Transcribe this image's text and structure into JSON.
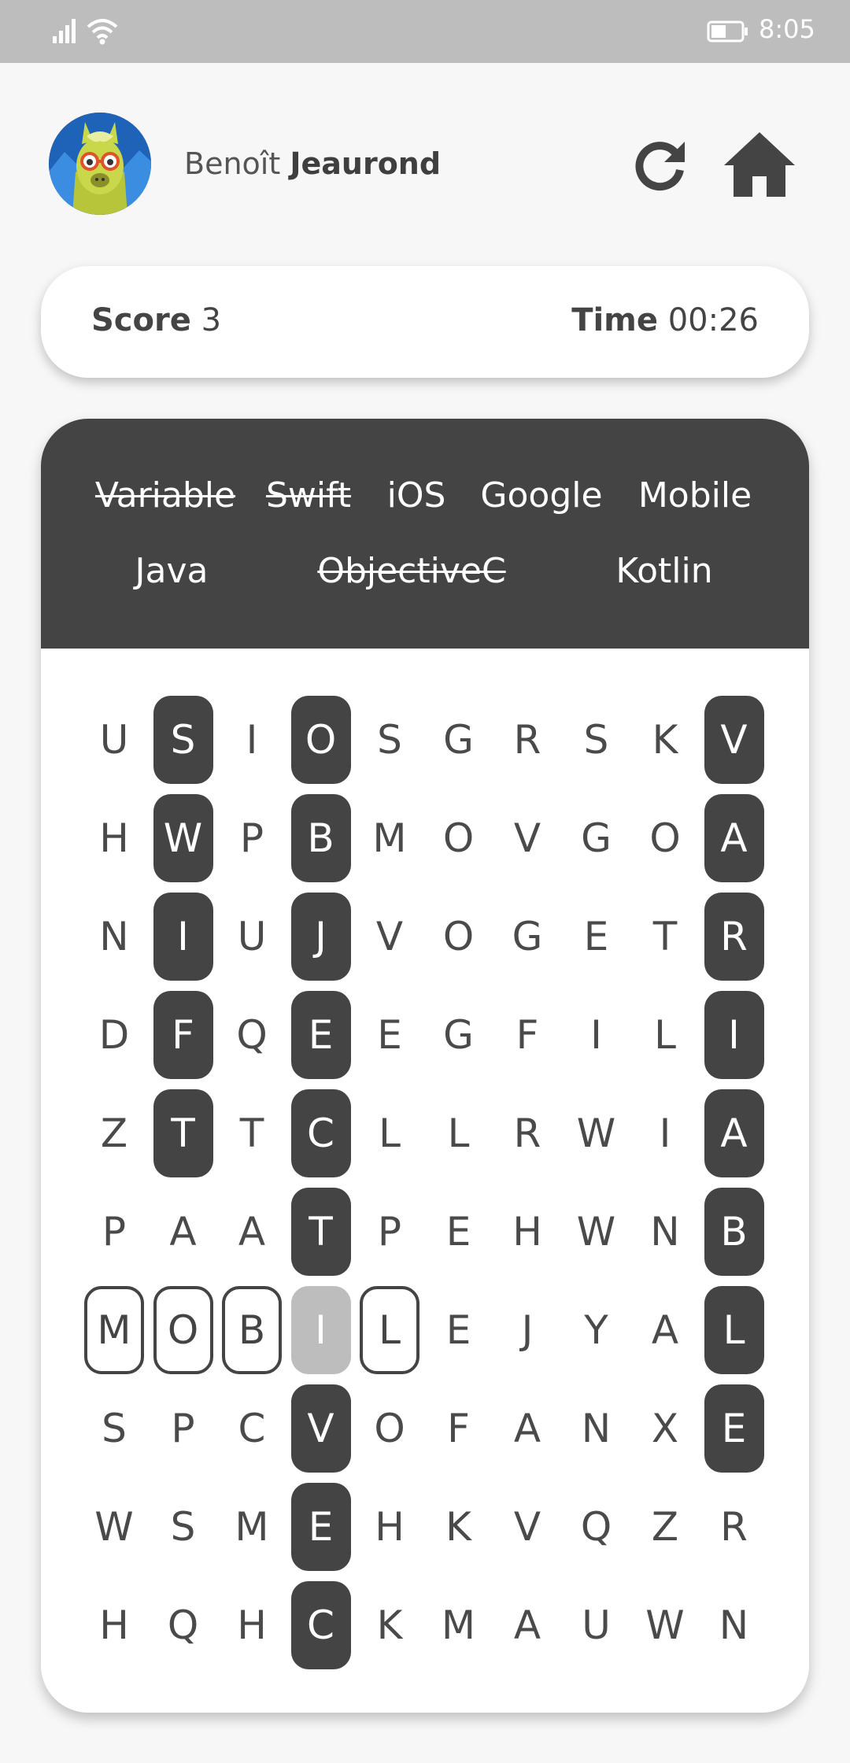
{
  "status_bar": {
    "time": "8:05"
  },
  "header": {
    "user_first": "Benoît",
    "user_last": "Jeaurond",
    "avatar_icon": "llama-avatar",
    "refresh_icon": "refresh-icon",
    "home_icon": "home-icon"
  },
  "score_bar": {
    "score_label": "Score",
    "score_value": "3",
    "time_label": "Time",
    "time_value": "00:26"
  },
  "word_list": [
    {
      "text": "Variable",
      "found": true
    },
    {
      "text": "Swift",
      "found": true
    },
    {
      "text": "iOS",
      "found": false
    },
    {
      "text": "Google",
      "found": false
    },
    {
      "text": "Mobile",
      "found": false
    },
    {
      "text": "Java",
      "found": false
    },
    {
      "text": "ObjectiveC",
      "found": true
    },
    {
      "text": "Kotlin",
      "found": false
    }
  ],
  "grid": [
    [
      "U",
      "S",
      "I",
      "O",
      "S",
      "G",
      "R",
      "S",
      "K",
      "V"
    ],
    [
      "H",
      "W",
      "P",
      "B",
      "M",
      "O",
      "V",
      "G",
      "O",
      "A"
    ],
    [
      "N",
      "I",
      "U",
      "J",
      "V",
      "O",
      "G",
      "E",
      "T",
      "R"
    ],
    [
      "D",
      "F",
      "Q",
      "E",
      "E",
      "G",
      "F",
      "I",
      "L",
      "I"
    ],
    [
      "Z",
      "T",
      "T",
      "C",
      "L",
      "L",
      "R",
      "W",
      "I",
      "A"
    ],
    [
      "P",
      "A",
      "A",
      "T",
      "P",
      "E",
      "H",
      "W",
      "N",
      "B"
    ],
    [
      "M",
      "O",
      "B",
      "I",
      "L",
      "E",
      "J",
      "Y",
      "A",
      "L"
    ],
    [
      "S",
      "P",
      "C",
      "V",
      "O",
      "F",
      "A",
      "N",
      "X",
      "E"
    ],
    [
      "W",
      "S",
      "M",
      "E",
      "H",
      "K",
      "V",
      "Q",
      "Z",
      "R"
    ],
    [
      "H",
      "Q",
      "H",
      "C",
      "K",
      "M",
      "A",
      "U",
      "W",
      "N"
    ]
  ],
  "found_cells": [
    [
      0,
      1
    ],
    [
      1,
      1
    ],
    [
      2,
      1
    ],
    [
      3,
      1
    ],
    [
      4,
      1
    ],
    [
      0,
      3
    ],
    [
      1,
      3
    ],
    [
      2,
      3
    ],
    [
      3,
      3
    ],
    [
      4,
      3
    ],
    [
      5,
      3
    ],
    [
      7,
      3
    ],
    [
      8,
      3
    ],
    [
      9,
      3
    ],
    [
      0,
      9
    ],
    [
      1,
      9
    ],
    [
      2,
      9
    ],
    [
      3,
      9
    ],
    [
      4,
      9
    ],
    [
      5,
      9
    ],
    [
      6,
      9
    ],
    [
      7,
      9
    ]
  ],
  "selected_cells": [
    [
      6,
      0
    ],
    [
      6,
      1
    ],
    [
      6,
      2
    ],
    [
      6,
      4
    ]
  ],
  "cursor_cell": [
    6,
    3
  ],
  "colors": {
    "found": "#444444",
    "cursor": "#bdbdbd",
    "status_bar": "#bdbdbd"
  }
}
